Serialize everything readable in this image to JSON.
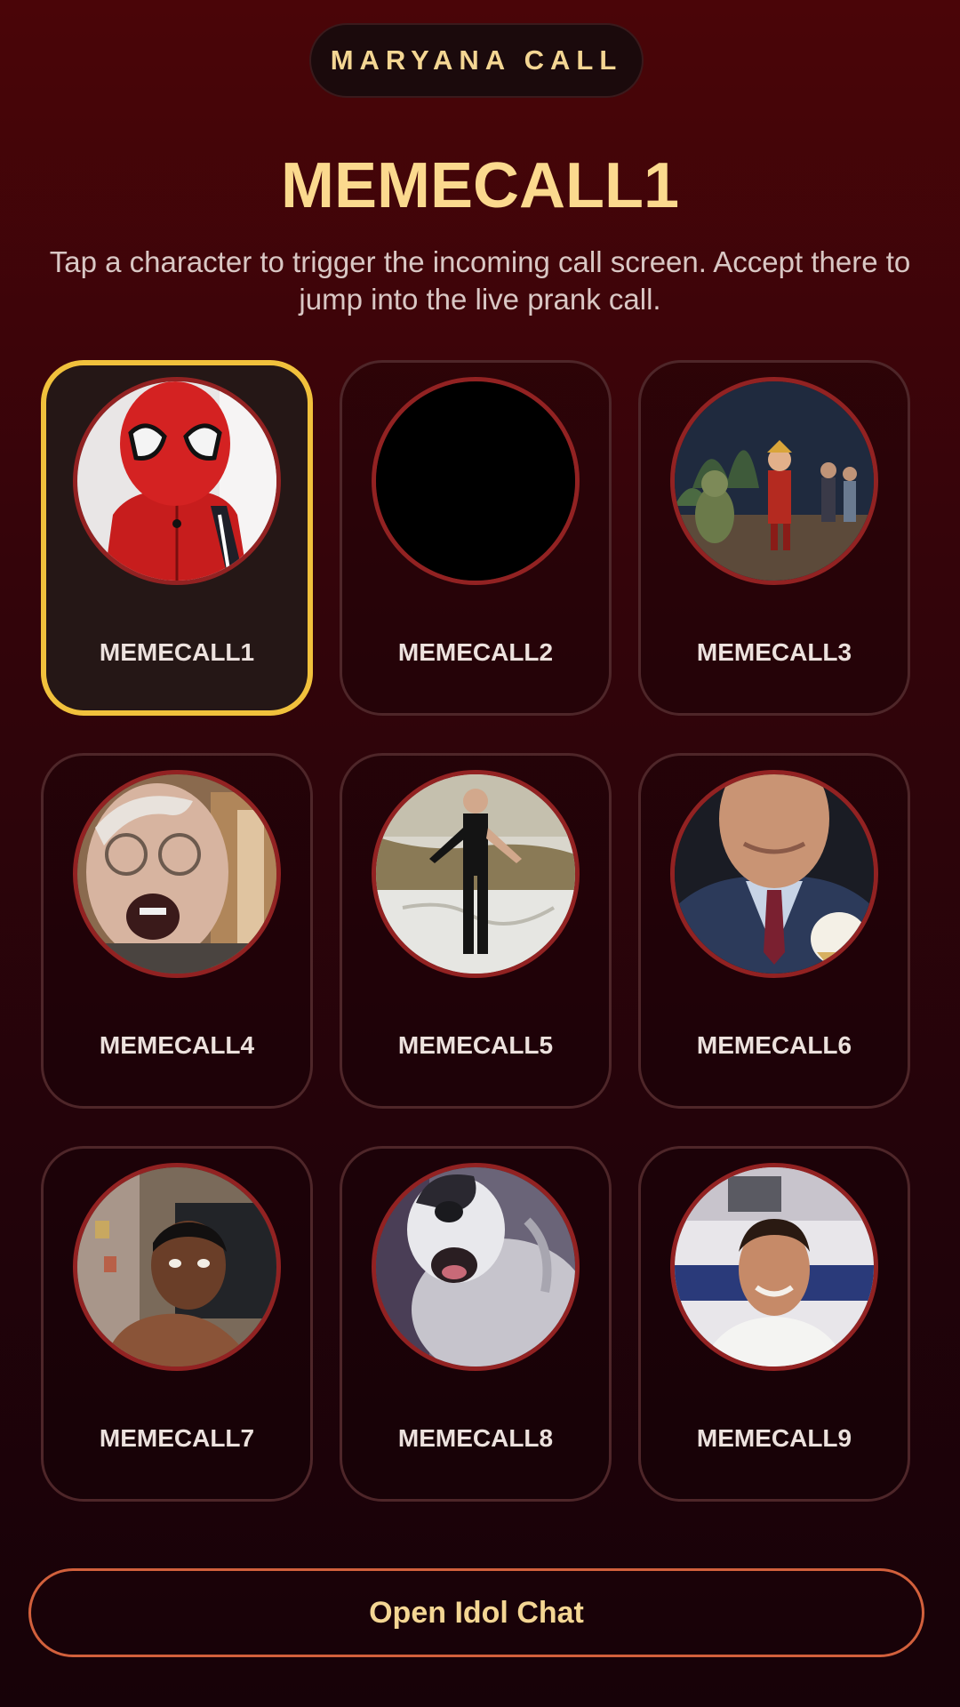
{
  "header": {
    "app_name": "MARYANA CALL",
    "title": "MEMECALL1",
    "subtitle": "Tap a character to trigger the incoming call screen. Accept there to jump into the live prank call."
  },
  "characters": [
    {
      "label": "MEMECALL1",
      "selected": true,
      "avatar": "spiderman-photo"
    },
    {
      "label": "MEMECALL2",
      "selected": false,
      "avatar": "black-placeholder"
    },
    {
      "label": "MEMECALL3",
      "selected": false,
      "avatar": "animated-scene-photo"
    },
    {
      "label": "MEMECALL4",
      "selected": false,
      "avatar": "old-man-shouting-photo"
    },
    {
      "label": "MEMECALL5",
      "selected": false,
      "avatar": "man-dancing-photo"
    },
    {
      "label": "MEMECALL6",
      "selected": false,
      "avatar": "man-in-suit-photo"
    },
    {
      "label": "MEMECALL7",
      "selected": false,
      "avatar": "young-man-photo"
    },
    {
      "label": "MEMECALL8",
      "selected": false,
      "avatar": "dog-photo"
    },
    {
      "label": "MEMECALL9",
      "selected": false,
      "avatar": "smiling-man-photo"
    }
  ],
  "footer": {
    "button_label": "Open Idol Chat"
  },
  "colors": {
    "accent_gold": "#f1c13c",
    "title_gold": "#fbd98e",
    "button_border": "#d2603c",
    "avatar_ring": "#922222"
  }
}
